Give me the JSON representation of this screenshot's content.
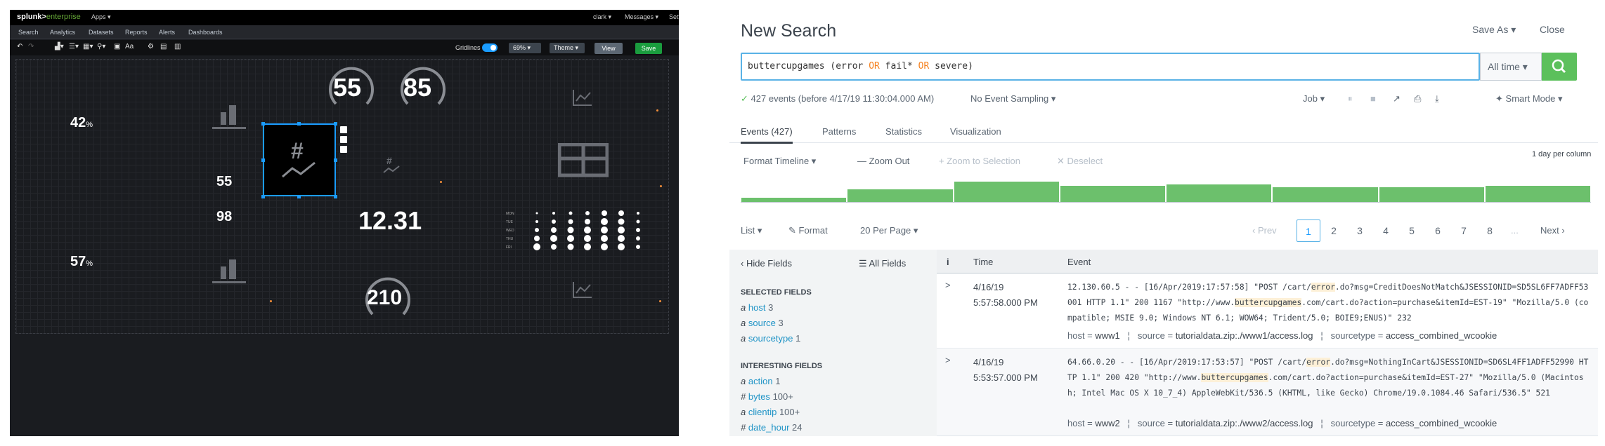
{
  "dashboard": {
    "logo": {
      "brand": "splunk>",
      "product": "enterprise"
    },
    "top_menu": {
      "apps": "Apps ▾",
      "user": "clark ▾",
      "messages": "Messages ▾",
      "settings": "Sett"
    },
    "app_nav": [
      "Search",
      "Analytics",
      "Datasets",
      "Reports",
      "Alerts",
      "Dashboards"
    ],
    "toolbar": {
      "gridlines_label": "Gridlines",
      "zoom": "69%",
      "theme": "Theme ▾",
      "view": "View",
      "save": "Save",
      "aa_label": "Aa"
    },
    "widgets": {
      "pct_top": "42",
      "pct_bottom": "57",
      "pct_unit": "%",
      "single_55": "55",
      "single_98": "98",
      "gauge_left": "55",
      "gauge_right": "85",
      "big_value": "12.31",
      "gauge_bottom": "210",
      "punchcard_rows": [
        "MON",
        "TUE",
        "WED",
        "THU",
        "FRI"
      ]
    }
  },
  "search": {
    "title": "New Search",
    "save_as": "Save As ▾",
    "close": "Close",
    "query_parts": {
      "a": "buttercupgames (error ",
      "or1": "OR",
      "b": " fail* ",
      "or2": "OR",
      "c": " severe)"
    },
    "time_range": "All time ▾",
    "status": {
      "check": "✓",
      "events": "427 events (before 4/17/19 11:30:04.000 AM)",
      "sampling": "No Event Sampling ▾",
      "job": "Job ▾",
      "smart_mode": "Smart Mode ▾"
    },
    "tabs": [
      "Events (427)",
      "Patterns",
      "Statistics",
      "Visualization"
    ],
    "timeline_bar": {
      "format": "Format Timeline ▾",
      "zoom_out": "— Zoom Out",
      "zoom_sel": "+ Zoom to Selection",
      "deselect": "✕ Deselect",
      "per_column": "1 day per column"
    },
    "timeline_levels": [
      0.16,
      0.48,
      0.78,
      0.62,
      0.68,
      0.56,
      0.58,
      0.62
    ],
    "list_controls": {
      "list": "List ▾",
      "format": "Format",
      "per_page": "20 Per Page ▾"
    },
    "pagination": {
      "prev": "‹ Prev",
      "pages": [
        "1",
        "2",
        "3",
        "4",
        "5",
        "6",
        "7",
        "8"
      ],
      "ellipsis": "...",
      "next": "Next ›"
    },
    "fields_sidebar": {
      "hide": "‹ Hide Fields",
      "all": "☰ All Fields",
      "selected_heading": "SELECTED FIELDS",
      "selected": [
        {
          "type": "a",
          "name": "host",
          "count": "3"
        },
        {
          "type": "a",
          "name": "source",
          "count": "3"
        },
        {
          "type": "a",
          "name": "sourcetype",
          "count": "1"
        }
      ],
      "interesting_heading": "INTERESTING FIELDS",
      "interesting": [
        {
          "type": "a",
          "name": "action",
          "count": "1"
        },
        {
          "type": "#",
          "name": "bytes",
          "count": "100+"
        },
        {
          "type": "a",
          "name": "clientip",
          "count": "100+"
        },
        {
          "type": "#",
          "name": "date_hour",
          "count": "24"
        }
      ]
    },
    "table_headers": {
      "info": "i",
      "time": "Time",
      "event": "Event"
    },
    "events": [
      {
        "date": "4/16/19",
        "time": "5:57:58.000 PM",
        "text_parts": {
          "p1": "12.130.60.5 - - [16/Apr/2019:17:57:58] \"POST /cart/",
          "h1": "error",
          "p2": ".do?msg=CreditDoesNotMatch&JSESSIONID=SD5SL6FF7ADFF53001 HTTP 1.1\" 200 1167 \"http://www.",
          "h2": "buttercupgames",
          "p3": ".com/cart.do?action=purchase&itemId=EST-19\" \"Mozilla/5.0 (compatible; MSIE 9.0; Windows NT 6.1; WOW64; Trident/5.0; BOIE9;ENUS)\" 232"
        },
        "host": "www1",
        "source": "tutorialdata.zip:./www1/access.log",
        "sourcetype": "access_combined_wcookie"
      },
      {
        "date": "4/16/19",
        "time": "5:53:57.000 PM",
        "text_parts": {
          "p1": "64.66.0.20 - - [16/Apr/2019:17:53:57] \"POST /cart/",
          "h1": "error",
          "p2": ".do?msg=NothingInCart&JSESSIONID=SD6SL4FF1ADFF52990 HTTP 1.1\" 200 420 \"http://www.",
          "h2": "buttercupgames",
          "p3": ".com/cart.do?action=purchase&itemId=EST-27\" \"Mozilla/5.0 (Macintosh; Intel Mac OS X 10_7_4) AppleWebKit/536.5 (KHTML, like Gecko) Chrome/19.0.1084.46 Safari/536.5\" 521"
        },
        "host": "www2",
        "source": "tutorialdata.zip:./www2/access.log",
        "sourcetype": "access_combined_wcookie"
      }
    ],
    "meta_labels": {
      "host": "host = ",
      "source": "source = ",
      "sourcetype": "sourcetype = "
    },
    "colors": {
      "accent": "#5cc05c",
      "link": "#1e93c6",
      "keyword": "#f58220",
      "selection": "#5ab2e6"
    }
  }
}
